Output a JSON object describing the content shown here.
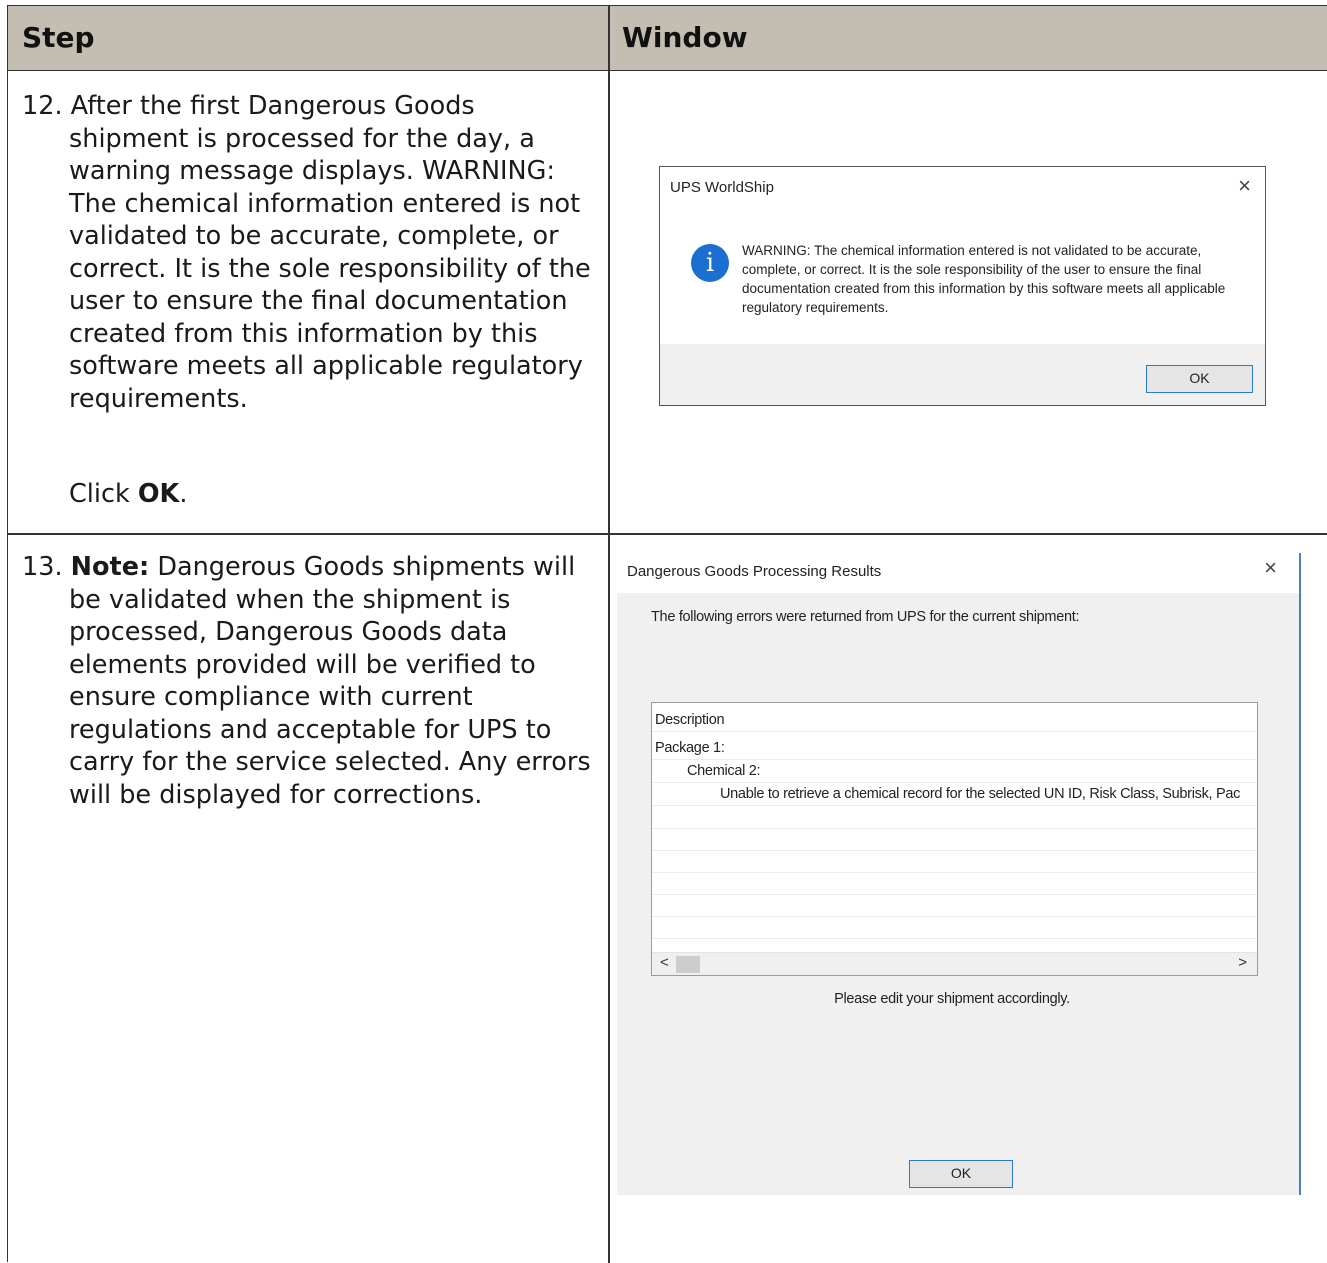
{
  "header": {
    "step": "Step",
    "window": "Window"
  },
  "step12": {
    "number": "12.",
    "text": "After the first Dangerous Goods shipment is processed for the day, a warning message displays. WARNING: The chemical information entered is not validated to be accurate, complete, or correct. It is the sole responsibility of the user to ensure the final documentation created from this information by this software meets all applicable regulatory requirements.",
    "click_prefix": "Click ",
    "click_bold": "OK",
    "click_suffix": "."
  },
  "step13": {
    "number": "13.",
    "note_label": "Note:",
    "text": "Dangerous Goods shipments will be validated when the shipment is processed, Dangerous Goods data elements provided will be verified to ensure compliance with current regulations and acceptable for UPS to carry for the service selected. Any errors will be displayed for corrections."
  },
  "dialog1": {
    "title": "UPS WorldShip",
    "close_icon": "×",
    "info_icon": "i",
    "message": "WARNING: The chemical information entered is not validated to be accurate, complete, or correct. It is the sole responsibility of the user to ensure the final documentation created from this information by this software meets all applicable regulatory requirements.",
    "ok_label": "OK"
  },
  "dialog2": {
    "title": "Dangerous Goods Processing Results",
    "close_icon": "×",
    "intro": "The following errors were returned from UPS for the current shipment:",
    "rows": [
      "Description",
      "Package 1:",
      "Chemical 2:",
      "Unable to retrieve a chemical record for the selected UN ID, Risk Class, Subrisk, Pac"
    ],
    "scroll_left": "<",
    "scroll_right": ">",
    "footer_text": "Please edit your shipment accordingly.",
    "ok_label": "OK"
  }
}
